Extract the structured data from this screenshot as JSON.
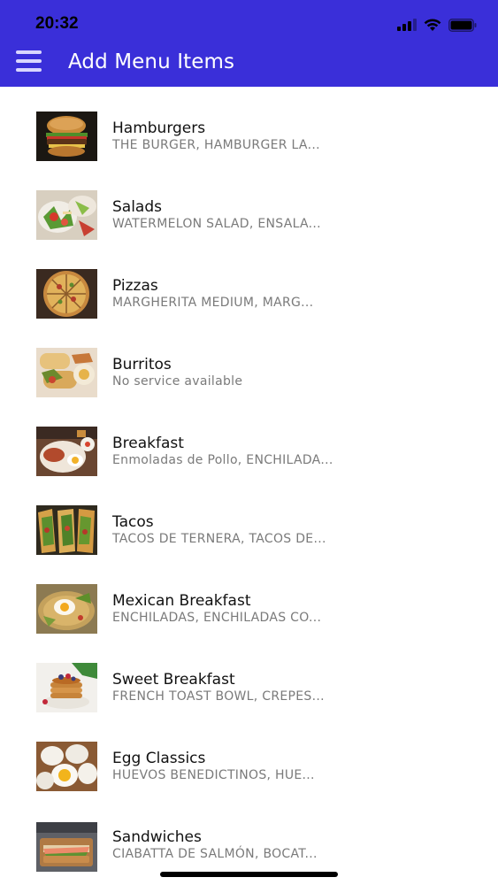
{
  "status_bar": {
    "time": "20:32"
  },
  "header": {
    "title": "Add Menu Items"
  },
  "colors": {
    "header_bg": "#3a2fd9",
    "title": "#ffffff",
    "subtitle": "#7a7a7a"
  },
  "menu_items": [
    {
      "title": "Hamburgers",
      "subtitle": "THE BURGER, HAMBURGER LA...",
      "thumbnail": "burger-photo"
    },
    {
      "title": "Salads",
      "subtitle": "WATERMELON SALAD, ENSALA...",
      "thumbnail": "salad-photo"
    },
    {
      "title": "Pizzas",
      "subtitle": "MARGHERITA MEDIUM, MARG...",
      "thumbnail": "pizza-photo"
    },
    {
      "title": "Burritos",
      "subtitle": "No service available",
      "thumbnail": "burrito-photo"
    },
    {
      "title": "Breakfast",
      "subtitle": "Enmoladas de Pollo, ENCHILADA...",
      "thumbnail": "breakfast-photo"
    },
    {
      "title": "Tacos",
      "subtitle": "TACOS DE TERNERA, TACOS DE...",
      "thumbnail": "tacos-photo"
    },
    {
      "title": "Mexican Breakfast",
      "subtitle": "ENCHILADAS, ENCHILADAS CO...",
      "thumbnail": "mexican-breakfast-photo"
    },
    {
      "title": "Sweet Breakfast",
      "subtitle": "FRENCH TOAST BOWL, CREPES...",
      "thumbnail": "pancakes-photo"
    },
    {
      "title": "Egg Classics",
      "subtitle": "HUEVOS BENEDICTINOS, HUE...",
      "thumbnail": "eggs-photo"
    },
    {
      "title": "Sandwiches",
      "subtitle": "CIABATTA DE SALMÓN, BOCAT...",
      "thumbnail": "sandwich-photo"
    }
  ]
}
